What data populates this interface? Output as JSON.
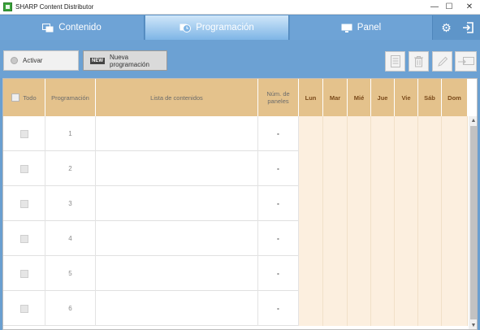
{
  "window": {
    "title": "SHARP Content Distributor",
    "minimize": "—",
    "maximize": "☐",
    "close": "✕"
  },
  "nav": {
    "tabs": [
      {
        "label": "Contenido",
        "icon": "content-icon"
      },
      {
        "label": "Programación",
        "icon": "schedule-icon"
      },
      {
        "label": "Panel",
        "icon": "panel-icon"
      }
    ],
    "active_tab": "Programación",
    "settings_icon": "gear-icon",
    "exit_icon": "exit-icon"
  },
  "toolbar": {
    "activate_label": "Activar",
    "new_badge": "NEW",
    "new_schedule_label": "Nueva programación",
    "icons": [
      "list-icon",
      "trash-icon",
      "pencil-icon",
      "send-to-panel-icon"
    ]
  },
  "table": {
    "headers": {
      "all": "Todo",
      "schedule": "Programación",
      "content_list": "Lista de contenidos",
      "panels": "Núm. de paneles",
      "days": [
        "Lun",
        "Mar",
        "Mié",
        "Jue",
        "Vie",
        "Sáb",
        "Dom"
      ]
    },
    "rows": [
      {
        "number": "1",
        "content_list": "",
        "panels": "-"
      },
      {
        "number": "2",
        "content_list": "",
        "panels": "-"
      },
      {
        "number": "3",
        "content_list": "",
        "panels": "-"
      },
      {
        "number": "4",
        "content_list": "",
        "panels": "-"
      },
      {
        "number": "5",
        "content_list": "",
        "panels": "-"
      },
      {
        "number": "6",
        "content_list": "",
        "panels": "-"
      }
    ]
  },
  "colors": {
    "header_bg": "#e4c28c",
    "day_cell_bg": "#fcefdf",
    "accent": "#6ca1d3"
  }
}
